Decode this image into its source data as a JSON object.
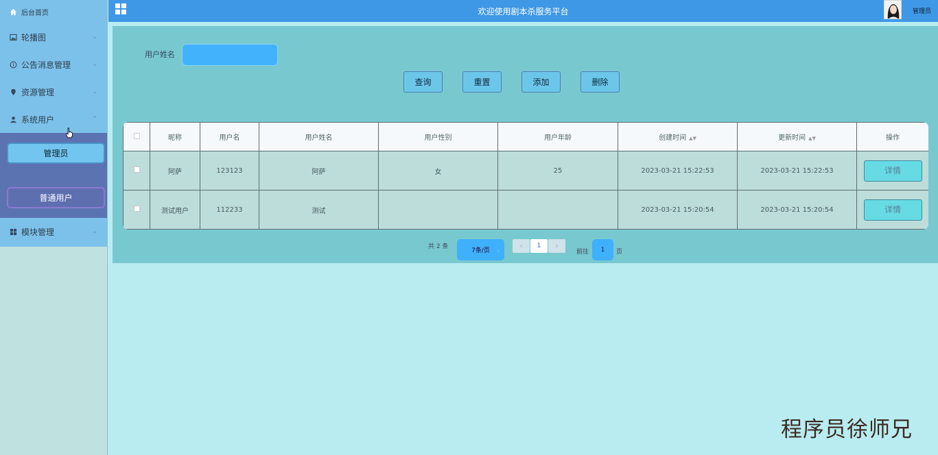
{
  "sidebar": {
    "home": {
      "label": "后台首页",
      "icon": "home-icon"
    },
    "items": [
      {
        "label": "轮播图",
        "icon": "image-icon"
      },
      {
        "label": "公告消息管理",
        "icon": "info-circle-icon"
      },
      {
        "label": "资源管理",
        "icon": "map-pin-icon"
      },
      {
        "label": "系统用户",
        "icon": "user-icon"
      }
    ],
    "submenu": [
      {
        "label": "管理员"
      },
      {
        "label": "普通用户"
      }
    ],
    "modules": {
      "label": "模块管理",
      "icon": "grid-icon"
    }
  },
  "header": {
    "title": "欢迎使用剧本杀服务平台",
    "username": "管理员"
  },
  "search": {
    "label": "用户姓名",
    "value": ""
  },
  "actions": {
    "query": "查询",
    "reset": "重置",
    "add": "添加",
    "delete": "删除"
  },
  "table": {
    "columns": [
      "昵称",
      "用户名",
      "用户姓名",
      "用户性别",
      "用户年龄",
      "创建时间",
      "更新时间",
      "操作"
    ],
    "rows": [
      {
        "nickname": "阿萨",
        "username": "123123",
        "realname": "阿萨",
        "gender": "女",
        "age": "25",
        "created": "2023-03-21 15:22:53",
        "updated": "2023-03-21 15:22:53",
        "action": "详情"
      },
      {
        "nickname": "测试用户",
        "username": "112233",
        "realname": "测试",
        "gender": "",
        "age": "",
        "created": "2023-03-21 15:20:54",
        "updated": "2023-03-21 15:20:54",
        "action": "详情"
      }
    ]
  },
  "pagination": {
    "total": "共 2 条",
    "page_size": "7条/页",
    "prev": "‹",
    "next": "›",
    "current": "1",
    "goto_label": "前往",
    "goto_value": "1",
    "goto_unit": "页"
  },
  "watermark": "程序员徐师兄",
  "colors": {
    "topbar": "#3f98e6",
    "sidebar": "#7cc1ea",
    "submenu": "#5b73b0",
    "panel": "#78c8d0",
    "background": "#b9ecf0"
  }
}
